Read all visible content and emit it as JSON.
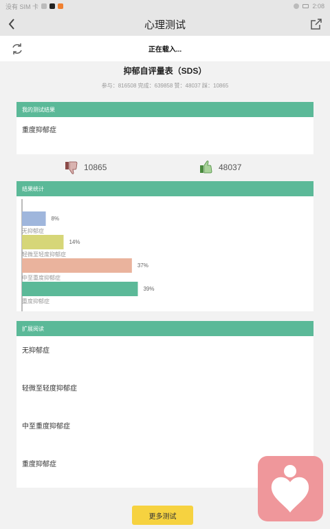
{
  "statusbar": {
    "carrier": "没有 SIM 卡",
    "time": "2:08"
  },
  "nav": {
    "title": "心理测试"
  },
  "loading": {
    "text": "正在载入..."
  },
  "test": {
    "title": "抑郁自评量表（SDS）",
    "stats": "参与：816508 完成：639858 赞：48037 踩：10865"
  },
  "result": {
    "header": "我的测试结果",
    "value": "重度抑郁症"
  },
  "votes": {
    "dislike": "10865",
    "like": "48037"
  },
  "stats_card": {
    "header": "结果统计"
  },
  "chart_data": {
    "type": "bar",
    "orientation": "horizontal",
    "categories": [
      "无抑郁症",
      "轻微至轻度抑郁症",
      "中至重度抑郁症",
      "重度抑郁症"
    ],
    "values": [
      8,
      14,
      37,
      39
    ],
    "value_labels": [
      "8%",
      "14%",
      "37%",
      "39%"
    ],
    "colors": [
      "#9fb6dc",
      "#d6d678",
      "#eab39d",
      "#5bb998"
    ],
    "xlim": [
      0,
      100
    ]
  },
  "reading": {
    "header": "扩展阅读",
    "items": [
      "无抑郁症",
      "轻微至轻度抑郁症",
      "中至重度抑郁症",
      "重度抑郁症"
    ]
  },
  "more_button": "更多测试",
  "colors": {
    "accent": "#5bb998",
    "button": "#f6d240",
    "logo": "#ef979b"
  }
}
